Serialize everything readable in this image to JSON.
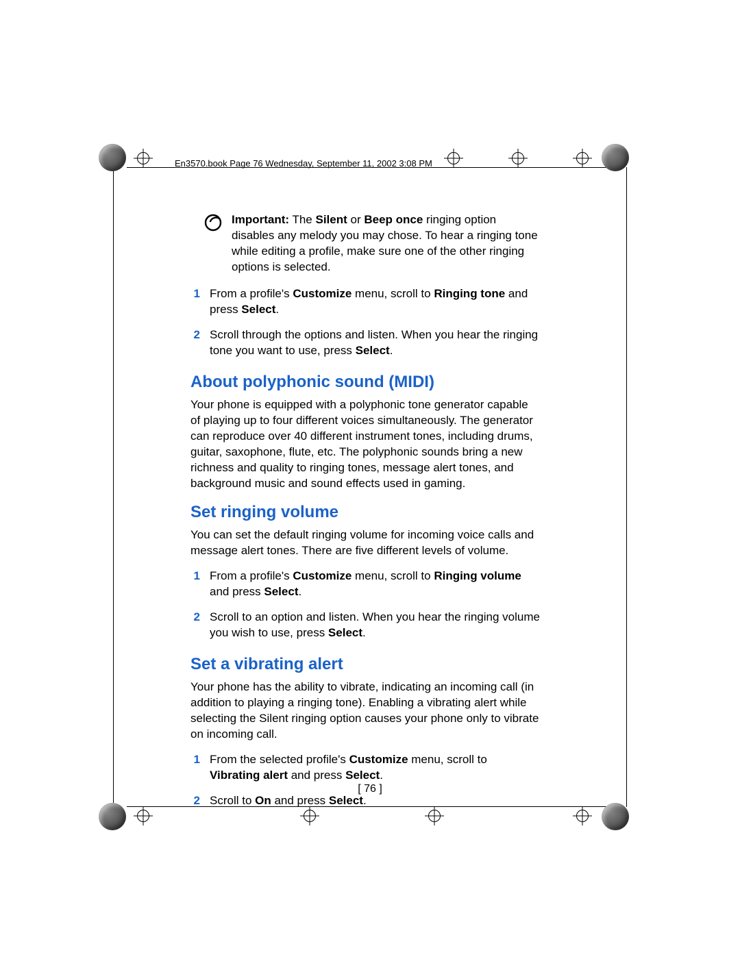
{
  "header": {
    "running_line": "En3570.book  Page 76  Wednesday, September 11, 2002  3:08 PM"
  },
  "important_note": {
    "label": "Important:",
    "body_1": " The ",
    "bold_a": "Silent",
    "mid_1": " or ",
    "bold_b": "Beep once",
    "body_2": " ringing option disables any melody you may chose. To hear a ringing tone while editing a profile, make sure one of the other ringing options is selected."
  },
  "steps_ringing_tone": [
    {
      "num": "1",
      "pre": "From a profile's ",
      "b1": "Customize",
      "mid": " menu, scroll to ",
      "b2": "Ringing tone",
      "mid2": " and press ",
      "b3": "Select",
      "post": "."
    },
    {
      "num": "2",
      "pre": "Scroll through the options and listen. When you hear the ringing tone you want to use, press ",
      "b1": "Select",
      "post": "."
    }
  ],
  "section_midi": {
    "title": "About polyphonic sound (MIDI)",
    "body": "Your phone is equipped with a polyphonic tone generator capable of playing up to four different voices simultaneously. The generator can reproduce over 40 different instrument tones, including drums, guitar, saxophone, flute, etc. The polyphonic sounds bring a new richness and quality to ringing tones, message alert tones, and background music and sound effects used in gaming."
  },
  "section_volume": {
    "title": "Set ringing volume",
    "body": "You can set the default ringing volume for incoming voice calls and message alert tones. There are five different levels of volume.",
    "steps": [
      {
        "num": "1",
        "pre": "From a profile's ",
        "b1": "Customize",
        "mid": " menu, scroll to ",
        "b2": "Ringing volume",
        "mid2": " and press ",
        "b3": "Select",
        "post": "."
      },
      {
        "num": "2",
        "pre": "Scroll to an option and listen. When you hear the ringing volume you wish to use, press ",
        "b1": "Select",
        "post": "."
      }
    ]
  },
  "section_vibrate": {
    "title": "Set a vibrating alert",
    "body": "Your phone has the ability to vibrate, indicating an incoming call (in addition to playing a ringing tone). Enabling a vibrating alert while selecting the Silent ringing option causes your phone only to vibrate on incoming call.",
    "steps": [
      {
        "num": "1",
        "pre": "From the selected profile's ",
        "b1": "Customize",
        "mid": " menu, scroll to ",
        "b2": "Vibrating alert",
        "mid2": " and press ",
        "b3": "Select",
        "post": "."
      },
      {
        "num": "2",
        "pre": "Scroll to ",
        "b1": "On",
        "mid": " and press ",
        "b2": "Select",
        "post": "."
      }
    ]
  },
  "page_number": "[ 76 ]"
}
